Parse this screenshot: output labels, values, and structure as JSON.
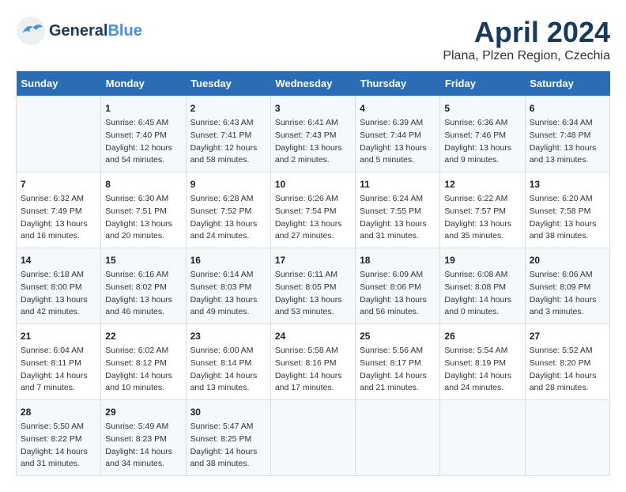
{
  "logo": {
    "part1": "General",
    "part2": "Blue"
  },
  "title": "April 2024",
  "subtitle": "Plana, Plzen Region, Czechia",
  "days_header": [
    "Sunday",
    "Monday",
    "Tuesday",
    "Wednesday",
    "Thursday",
    "Friday",
    "Saturday"
  ],
  "weeks": [
    [
      {
        "num": "",
        "info": ""
      },
      {
        "num": "1",
        "info": "Sunrise: 6:45 AM\nSunset: 7:40 PM\nDaylight: 12 hours\nand 54 minutes."
      },
      {
        "num": "2",
        "info": "Sunrise: 6:43 AM\nSunset: 7:41 PM\nDaylight: 12 hours\nand 58 minutes."
      },
      {
        "num": "3",
        "info": "Sunrise: 6:41 AM\nSunset: 7:43 PM\nDaylight: 13 hours\nand 2 minutes."
      },
      {
        "num": "4",
        "info": "Sunrise: 6:39 AM\nSunset: 7:44 PM\nDaylight: 13 hours\nand 5 minutes."
      },
      {
        "num": "5",
        "info": "Sunrise: 6:36 AM\nSunset: 7:46 PM\nDaylight: 13 hours\nand 9 minutes."
      },
      {
        "num": "6",
        "info": "Sunrise: 6:34 AM\nSunset: 7:48 PM\nDaylight: 13 hours\nand 13 minutes."
      }
    ],
    [
      {
        "num": "7",
        "info": "Sunrise: 6:32 AM\nSunset: 7:49 PM\nDaylight: 13 hours\nand 16 minutes."
      },
      {
        "num": "8",
        "info": "Sunrise: 6:30 AM\nSunset: 7:51 PM\nDaylight: 13 hours\nand 20 minutes."
      },
      {
        "num": "9",
        "info": "Sunrise: 6:28 AM\nSunset: 7:52 PM\nDaylight: 13 hours\nand 24 minutes."
      },
      {
        "num": "10",
        "info": "Sunrise: 6:26 AM\nSunset: 7:54 PM\nDaylight: 13 hours\nand 27 minutes."
      },
      {
        "num": "11",
        "info": "Sunrise: 6:24 AM\nSunset: 7:55 PM\nDaylight: 13 hours\nand 31 minutes."
      },
      {
        "num": "12",
        "info": "Sunrise: 6:22 AM\nSunset: 7:57 PM\nDaylight: 13 hours\nand 35 minutes."
      },
      {
        "num": "13",
        "info": "Sunrise: 6:20 AM\nSunset: 7:58 PM\nDaylight: 13 hours\nand 38 minutes."
      }
    ],
    [
      {
        "num": "14",
        "info": "Sunrise: 6:18 AM\nSunset: 8:00 PM\nDaylight: 13 hours\nand 42 minutes."
      },
      {
        "num": "15",
        "info": "Sunrise: 6:16 AM\nSunset: 8:02 PM\nDaylight: 13 hours\nand 46 minutes."
      },
      {
        "num": "16",
        "info": "Sunrise: 6:14 AM\nSunset: 8:03 PM\nDaylight: 13 hours\nand 49 minutes."
      },
      {
        "num": "17",
        "info": "Sunrise: 6:11 AM\nSunset: 8:05 PM\nDaylight: 13 hours\nand 53 minutes."
      },
      {
        "num": "18",
        "info": "Sunrise: 6:09 AM\nSunset: 8:06 PM\nDaylight: 13 hours\nand 56 minutes."
      },
      {
        "num": "19",
        "info": "Sunrise: 6:08 AM\nSunset: 8:08 PM\nDaylight: 14 hours\nand 0 minutes."
      },
      {
        "num": "20",
        "info": "Sunrise: 6:06 AM\nSunset: 8:09 PM\nDaylight: 14 hours\nand 3 minutes."
      }
    ],
    [
      {
        "num": "21",
        "info": "Sunrise: 6:04 AM\nSunset: 8:11 PM\nDaylight: 14 hours\nand 7 minutes."
      },
      {
        "num": "22",
        "info": "Sunrise: 6:02 AM\nSunset: 8:12 PM\nDaylight: 14 hours\nand 10 minutes."
      },
      {
        "num": "23",
        "info": "Sunrise: 6:00 AM\nSunset: 8:14 PM\nDaylight: 14 hours\nand 13 minutes."
      },
      {
        "num": "24",
        "info": "Sunrise: 5:58 AM\nSunset: 8:16 PM\nDaylight: 14 hours\nand 17 minutes."
      },
      {
        "num": "25",
        "info": "Sunrise: 5:56 AM\nSunset: 8:17 PM\nDaylight: 14 hours\nand 21 minutes."
      },
      {
        "num": "26",
        "info": "Sunrise: 5:54 AM\nSunset: 8:19 PM\nDaylight: 14 hours\nand 24 minutes."
      },
      {
        "num": "27",
        "info": "Sunrise: 5:52 AM\nSunset: 8:20 PM\nDaylight: 14 hours\nand 28 minutes."
      }
    ],
    [
      {
        "num": "28",
        "info": "Sunrise: 5:50 AM\nSunset: 8:22 PM\nDaylight: 14 hours\nand 31 minutes."
      },
      {
        "num": "29",
        "info": "Sunrise: 5:49 AM\nSunset: 8:23 PM\nDaylight: 14 hours\nand 34 minutes."
      },
      {
        "num": "30",
        "info": "Sunrise: 5:47 AM\nSunset: 8:25 PM\nDaylight: 14 hours\nand 38 minutes."
      },
      {
        "num": "",
        "info": ""
      },
      {
        "num": "",
        "info": ""
      },
      {
        "num": "",
        "info": ""
      },
      {
        "num": "",
        "info": ""
      }
    ]
  ]
}
